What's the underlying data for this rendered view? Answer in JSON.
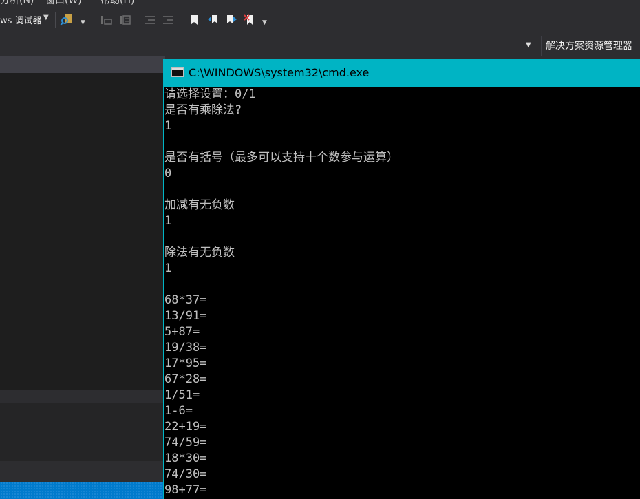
{
  "menubar": {
    "items": [
      "分析(N)",
      "窗口(W)",
      "帮助(H)"
    ]
  },
  "toolbar": {
    "debugger_label": "ws 调试器",
    "icons": [
      "find-in-files-icon",
      "comment-icon",
      "uncomment-icon",
      "outdent-icon",
      "indent-icon",
      "bookmark-icon",
      "prev-bookmark-icon",
      "next-bookmark-icon",
      "clear-bookmarks-icon"
    ]
  },
  "solution_explorer": {
    "title": "解决方案资源管理器"
  },
  "cmd": {
    "title": "C:\\WINDOWS\\system32\\cmd.exe",
    "lines": [
      "请选择设置：0/1",
      "是否有乘除法?",
      "1",
      "",
      "是否有括号（最多可以支持十个数参与运算）",
      "0",
      "",
      "加减有无负数",
      "1",
      "",
      "除法有无负数",
      "1",
      "",
      "68*37=",
      "13/91=",
      "5+87=",
      "19/38=",
      "17*95=",
      "67*28=",
      "1/51=",
      "1-6=",
      "22+19=",
      "74/59=",
      "18*30=",
      "74/30=",
      "98+77="
    ]
  },
  "colors": {
    "cmd_titlebar": "#00b4c4",
    "cmd_text": "#c0c0c0",
    "vs_background": "#2d2d30",
    "statusbar": "#007acc"
  }
}
